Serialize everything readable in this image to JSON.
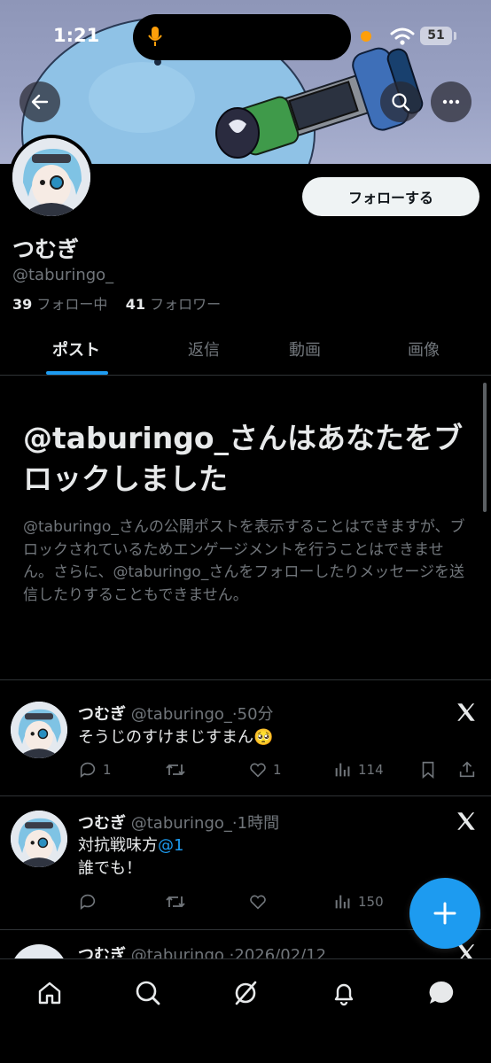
{
  "status_bar": {
    "time": "1:21",
    "battery": "51"
  },
  "profile": {
    "display_name": "つむぎ",
    "handle": "@taburingo_",
    "following_count": "39",
    "following_label": "フォロー中",
    "followers_count": "41",
    "followers_label": "フォロワー",
    "follow_button_label": "フォローする"
  },
  "tabs": [
    "ポスト",
    "返信",
    "動画",
    "画像"
  ],
  "blocked": {
    "title": "@taburingo_さんはあなたをブロックしました",
    "description": "@taburingo_さんの公開ポストを表示することはできますが、ブロックされているためエンゲージメントを行うことはできません。さらに、@taburingo_さんをフォローしたりメッセージを送信したりすることもできません。"
  },
  "tweets": [
    {
      "name": "つむぎ",
      "handle": "@taburingo_",
      "time": "·50分",
      "text_line1": "そうじのすけまじすまん🥺",
      "reply_count": "1",
      "like_count": "1",
      "view_count": "114"
    },
    {
      "name": "つむぎ",
      "handle": "@taburingo_",
      "time": "·1時間",
      "text_before_mention": "対抗戦味方",
      "mention": "@1",
      "text_line2": "誰でも！",
      "view_count": "150"
    },
    {
      "name": "つむぎ",
      "handle": "@taburingo",
      "time": "·2026/02/12"
    }
  ],
  "icons": {
    "back": "arrow-left-icon",
    "search": "search-icon",
    "more": "more-horizontal-icon",
    "x_logo": "x-logo-icon",
    "reply": "reply-icon",
    "repost": "repost-icon",
    "like": "heart-icon",
    "views": "views-icon",
    "bookmark": "bookmark-icon",
    "share": "share-icon",
    "compose": "plus-icon",
    "nav": [
      "home-icon",
      "search-icon",
      "grok-icon",
      "bell-icon",
      "messages-icon"
    ]
  },
  "colors": {
    "accent": "#1d9bf0",
    "background": "#000000",
    "text": "#e7e9ea",
    "muted": "#71767b"
  }
}
